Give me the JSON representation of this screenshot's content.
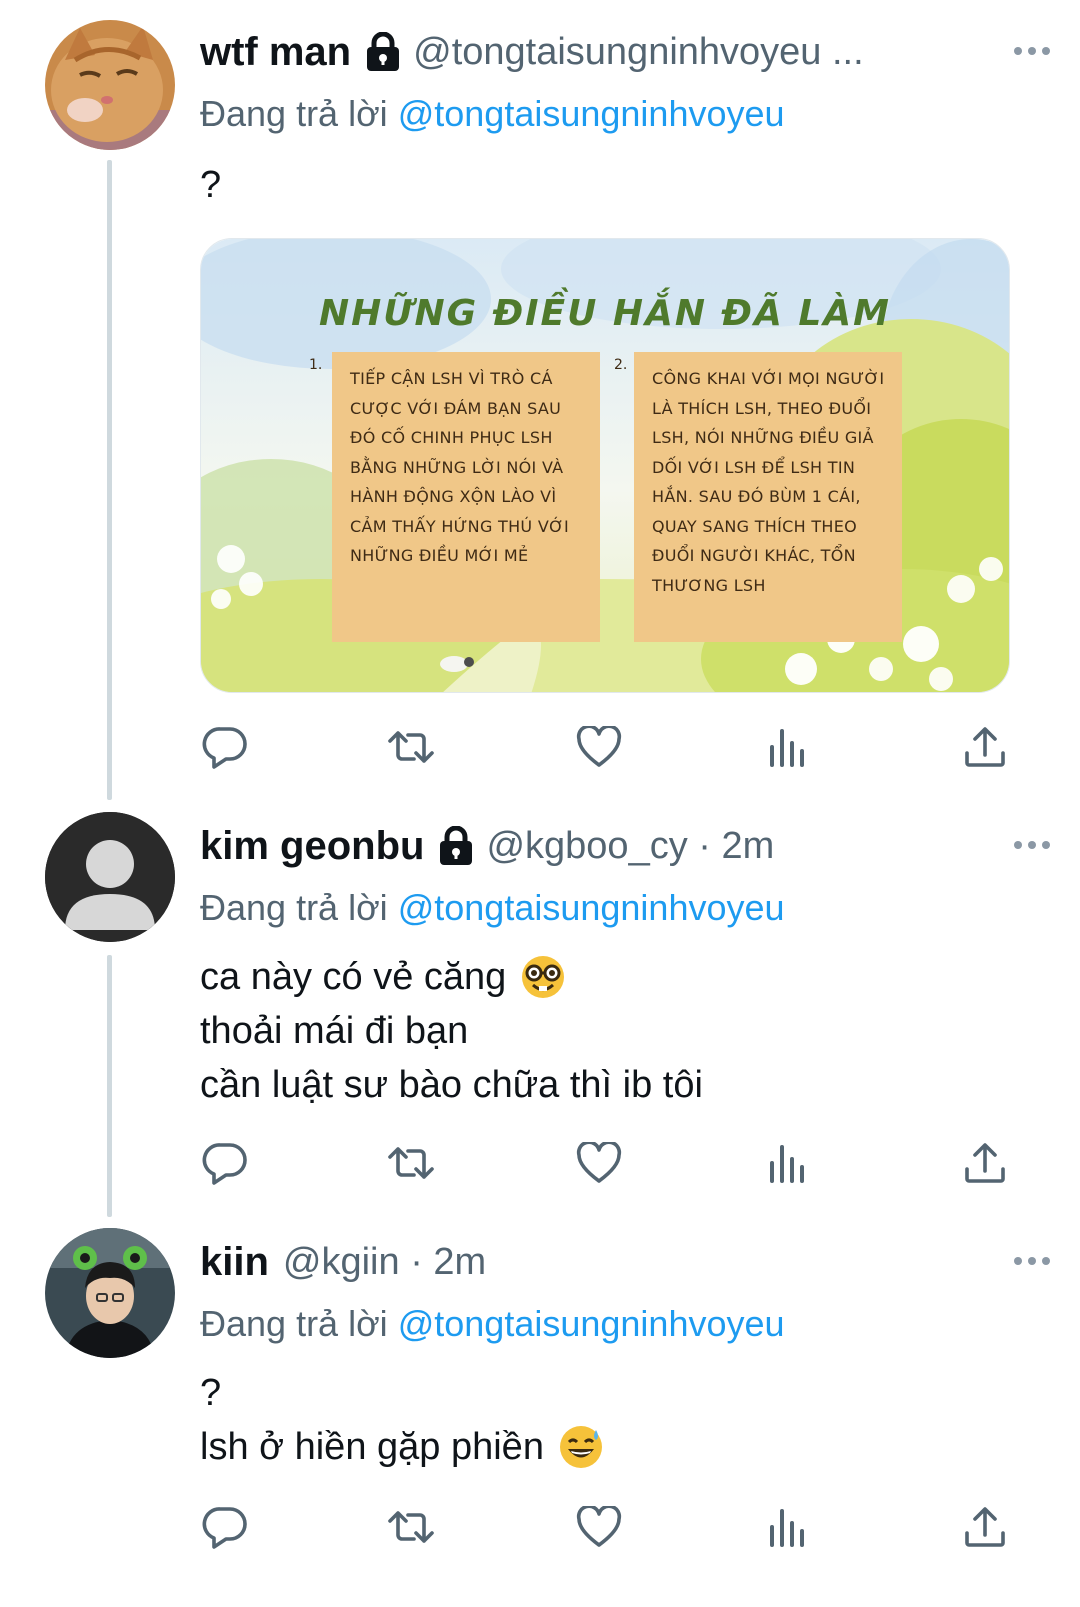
{
  "tweets": [
    {
      "name": "wtf man",
      "handle": "@tongtaisungninhvoyeu ...",
      "reply_prefix": "Đang trả lời",
      "reply_mention": "@tongtaisungninhvoyeu",
      "text": [
        "?"
      ],
      "card": {
        "title": "NHỮNG ĐIỀU HẮN ĐÃ LÀM",
        "items": [
          {
            "num": "1.",
            "text": "TIẾP CẬN LSH VÌ TRÒ CÁ CƯỢC VỚI ĐÁM BẠN SAU ĐÓ CỐ CHINH PHỤC LSH BẰNG NHỮNG LỜI NÓI VÀ HÀNH ĐỘNG XỘN LÀO VÌ CẢM THẤY HỨNG THÚ VỚI NHỮNG ĐIỀU MỚI MẺ"
          },
          {
            "num": "2.",
            "text": "CÔNG KHAI VỚI MỌI NGƯỜI LÀ THÍCH LSH, THEO ĐUỔI LSH, NÓI NHỮNG ĐIỀU GIẢ DỐI VỚI LSH ĐỂ LSH TIN HẮN. SAU ĐÓ BÙM 1 CÁI, QUAY SANG THÍCH THEO ĐUỔI NGƯỜI KHÁC, TỔN THƯƠNG LSH"
          }
        ]
      }
    },
    {
      "name": "kim geonbu",
      "handle": "@kgboo_cy · 2m",
      "reply_prefix": "Đang trả lời",
      "reply_mention": "@tongtaisungninhvoyeu",
      "text": [
        "ca này có vẻ căng",
        "thoải mái đi bạn",
        "cần luật sư bào chữa thì ib tôi"
      ]
    },
    {
      "name": "kiin",
      "handle": "@kgiin · 2m",
      "reply_prefix": "Đang trả lời",
      "reply_mention": "@tongtaisungninhvoyeu",
      "text": [
        "?",
        "lsh ở hiền gặp phiền"
      ]
    }
  ],
  "colors": {
    "accent": "#1d9bf0",
    "muted": "#536471",
    "icon": "#536471",
    "thread_line": "#cfd9de",
    "note_bg": "#f0c788"
  },
  "icons": [
    "reply-icon",
    "retweet-icon",
    "like-icon",
    "views-icon",
    "share-icon",
    "lock-icon",
    "more-icon"
  ]
}
